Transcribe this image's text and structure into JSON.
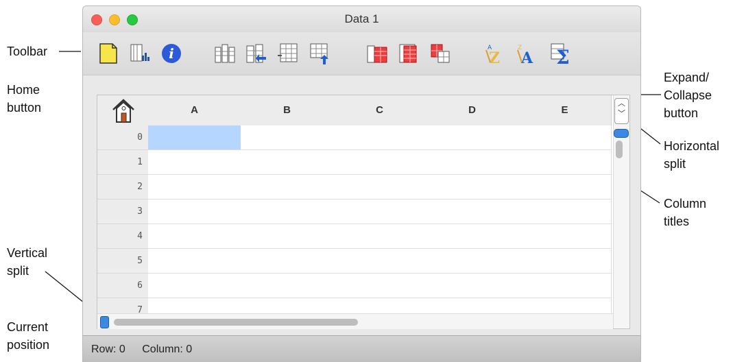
{
  "window": {
    "title": "Data 1"
  },
  "callouts": {
    "toolbar": "Toolbar",
    "home_line1": "Home",
    "home_line2": "button",
    "vsplit_line1": "Vertical",
    "vsplit_line2": "split",
    "curpos_line1": "Current",
    "curpos_line2": "position",
    "expand_line1": "Expand/",
    "expand_line2": "Collapse",
    "expand_line3": "button",
    "hsplit_line1": "Horizontal",
    "hsplit_line2": "split",
    "coltitles_line1": "Column",
    "coltitles_line2": "titles"
  },
  "toolbar": {
    "buttons": [
      {
        "icon": "new-document-icon"
      },
      {
        "icon": "chart-icon"
      },
      {
        "icon": "info-icon"
      },
      {
        "icon": "insert-column-icon"
      },
      {
        "icon": "insert-column-left-icon"
      },
      {
        "icon": "insert-row-icon"
      },
      {
        "icon": "insert-row-above-icon"
      },
      {
        "icon": "delete-column-icon"
      },
      {
        "icon": "delete-row-icon"
      },
      {
        "icon": "delete-cells-icon"
      },
      {
        "icon": "sort-ascending-icon"
      },
      {
        "icon": "sort-descending-icon"
      },
      {
        "icon": "sum-icon"
      }
    ]
  },
  "sheet": {
    "columns": [
      "A",
      "B",
      "C",
      "D",
      "E"
    ],
    "rows": [
      "0",
      "1",
      "2",
      "3",
      "4",
      "5",
      "6",
      "7"
    ],
    "selected": {
      "row": 0,
      "column": 0
    }
  },
  "status": {
    "row_text": "Row: 0",
    "column_text": "Column: 0"
  },
  "colors": {
    "selection": "#b5d6ff",
    "split_handle": "#3c89e0"
  }
}
